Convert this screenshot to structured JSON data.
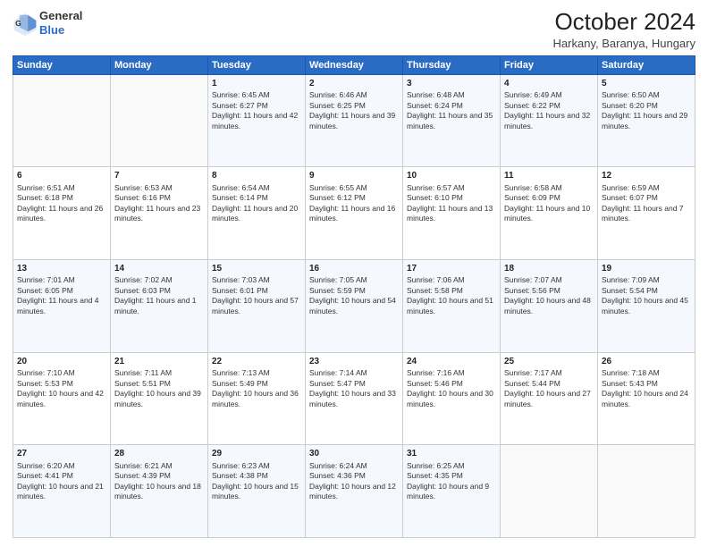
{
  "header": {
    "logo_general": "General",
    "logo_blue": "Blue",
    "month_year": "October 2024",
    "location": "Harkany, Baranya, Hungary"
  },
  "days_of_week": [
    "Sunday",
    "Monday",
    "Tuesday",
    "Wednesday",
    "Thursday",
    "Friday",
    "Saturday"
  ],
  "weeks": [
    [
      {
        "day": "",
        "sunrise": "",
        "sunset": "",
        "daylight": ""
      },
      {
        "day": "",
        "sunrise": "",
        "sunset": "",
        "daylight": ""
      },
      {
        "day": "1",
        "sunrise": "Sunrise: 6:45 AM",
        "sunset": "Sunset: 6:27 PM",
        "daylight": "Daylight: 11 hours and 42 minutes."
      },
      {
        "day": "2",
        "sunrise": "Sunrise: 6:46 AM",
        "sunset": "Sunset: 6:25 PM",
        "daylight": "Daylight: 11 hours and 39 minutes."
      },
      {
        "day": "3",
        "sunrise": "Sunrise: 6:48 AM",
        "sunset": "Sunset: 6:24 PM",
        "daylight": "Daylight: 11 hours and 35 minutes."
      },
      {
        "day": "4",
        "sunrise": "Sunrise: 6:49 AM",
        "sunset": "Sunset: 6:22 PM",
        "daylight": "Daylight: 11 hours and 32 minutes."
      },
      {
        "day": "5",
        "sunrise": "Sunrise: 6:50 AM",
        "sunset": "Sunset: 6:20 PM",
        "daylight": "Daylight: 11 hours and 29 minutes."
      }
    ],
    [
      {
        "day": "6",
        "sunrise": "Sunrise: 6:51 AM",
        "sunset": "Sunset: 6:18 PM",
        "daylight": "Daylight: 11 hours and 26 minutes."
      },
      {
        "day": "7",
        "sunrise": "Sunrise: 6:53 AM",
        "sunset": "Sunset: 6:16 PM",
        "daylight": "Daylight: 11 hours and 23 minutes."
      },
      {
        "day": "8",
        "sunrise": "Sunrise: 6:54 AM",
        "sunset": "Sunset: 6:14 PM",
        "daylight": "Daylight: 11 hours and 20 minutes."
      },
      {
        "day": "9",
        "sunrise": "Sunrise: 6:55 AM",
        "sunset": "Sunset: 6:12 PM",
        "daylight": "Daylight: 11 hours and 16 minutes."
      },
      {
        "day": "10",
        "sunrise": "Sunrise: 6:57 AM",
        "sunset": "Sunset: 6:10 PM",
        "daylight": "Daylight: 11 hours and 13 minutes."
      },
      {
        "day": "11",
        "sunrise": "Sunrise: 6:58 AM",
        "sunset": "Sunset: 6:09 PM",
        "daylight": "Daylight: 11 hours and 10 minutes."
      },
      {
        "day": "12",
        "sunrise": "Sunrise: 6:59 AM",
        "sunset": "Sunset: 6:07 PM",
        "daylight": "Daylight: 11 hours and 7 minutes."
      }
    ],
    [
      {
        "day": "13",
        "sunrise": "Sunrise: 7:01 AM",
        "sunset": "Sunset: 6:05 PM",
        "daylight": "Daylight: 11 hours and 4 minutes."
      },
      {
        "day": "14",
        "sunrise": "Sunrise: 7:02 AM",
        "sunset": "Sunset: 6:03 PM",
        "daylight": "Daylight: 11 hours and 1 minute."
      },
      {
        "day": "15",
        "sunrise": "Sunrise: 7:03 AM",
        "sunset": "Sunset: 6:01 PM",
        "daylight": "Daylight: 10 hours and 57 minutes."
      },
      {
        "day": "16",
        "sunrise": "Sunrise: 7:05 AM",
        "sunset": "Sunset: 5:59 PM",
        "daylight": "Daylight: 10 hours and 54 minutes."
      },
      {
        "day": "17",
        "sunrise": "Sunrise: 7:06 AM",
        "sunset": "Sunset: 5:58 PM",
        "daylight": "Daylight: 10 hours and 51 minutes."
      },
      {
        "day": "18",
        "sunrise": "Sunrise: 7:07 AM",
        "sunset": "Sunset: 5:56 PM",
        "daylight": "Daylight: 10 hours and 48 minutes."
      },
      {
        "day": "19",
        "sunrise": "Sunrise: 7:09 AM",
        "sunset": "Sunset: 5:54 PM",
        "daylight": "Daylight: 10 hours and 45 minutes."
      }
    ],
    [
      {
        "day": "20",
        "sunrise": "Sunrise: 7:10 AM",
        "sunset": "Sunset: 5:53 PM",
        "daylight": "Daylight: 10 hours and 42 minutes."
      },
      {
        "day": "21",
        "sunrise": "Sunrise: 7:11 AM",
        "sunset": "Sunset: 5:51 PM",
        "daylight": "Daylight: 10 hours and 39 minutes."
      },
      {
        "day": "22",
        "sunrise": "Sunrise: 7:13 AM",
        "sunset": "Sunset: 5:49 PM",
        "daylight": "Daylight: 10 hours and 36 minutes."
      },
      {
        "day": "23",
        "sunrise": "Sunrise: 7:14 AM",
        "sunset": "Sunset: 5:47 PM",
        "daylight": "Daylight: 10 hours and 33 minutes."
      },
      {
        "day": "24",
        "sunrise": "Sunrise: 7:16 AM",
        "sunset": "Sunset: 5:46 PM",
        "daylight": "Daylight: 10 hours and 30 minutes."
      },
      {
        "day": "25",
        "sunrise": "Sunrise: 7:17 AM",
        "sunset": "Sunset: 5:44 PM",
        "daylight": "Daylight: 10 hours and 27 minutes."
      },
      {
        "day": "26",
        "sunrise": "Sunrise: 7:18 AM",
        "sunset": "Sunset: 5:43 PM",
        "daylight": "Daylight: 10 hours and 24 minutes."
      }
    ],
    [
      {
        "day": "27",
        "sunrise": "Sunrise: 6:20 AM",
        "sunset": "Sunset: 4:41 PM",
        "daylight": "Daylight: 10 hours and 21 minutes."
      },
      {
        "day": "28",
        "sunrise": "Sunrise: 6:21 AM",
        "sunset": "Sunset: 4:39 PM",
        "daylight": "Daylight: 10 hours and 18 minutes."
      },
      {
        "day": "29",
        "sunrise": "Sunrise: 6:23 AM",
        "sunset": "Sunset: 4:38 PM",
        "daylight": "Daylight: 10 hours and 15 minutes."
      },
      {
        "day": "30",
        "sunrise": "Sunrise: 6:24 AM",
        "sunset": "Sunset: 4:36 PM",
        "daylight": "Daylight: 10 hours and 12 minutes."
      },
      {
        "day": "31",
        "sunrise": "Sunrise: 6:25 AM",
        "sunset": "Sunset: 4:35 PM",
        "daylight": "Daylight: 10 hours and 9 minutes."
      },
      {
        "day": "",
        "sunrise": "",
        "sunset": "",
        "daylight": ""
      },
      {
        "day": "",
        "sunrise": "",
        "sunset": "",
        "daylight": ""
      }
    ]
  ]
}
